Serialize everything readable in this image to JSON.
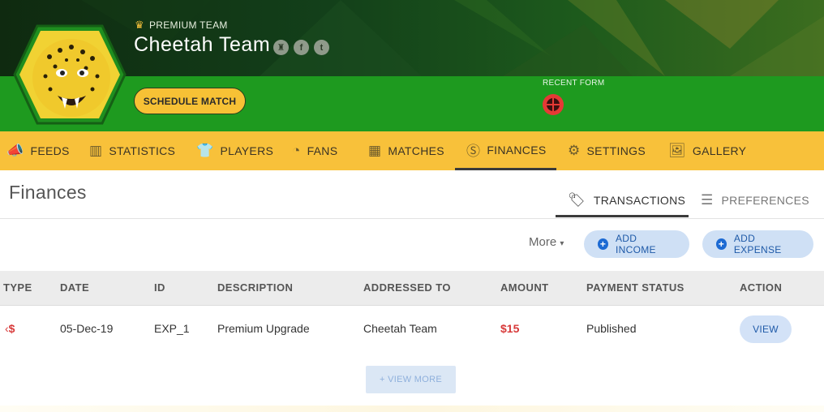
{
  "header": {
    "premium_label": "PREMIUM TEAM",
    "team_name": "Cheetah Team",
    "schedule_label": "SCHEDULE MATCH",
    "recent_form_label": "RECENT FORM",
    "social_icons": [
      "trophy-icon",
      "facebook-icon",
      "twitter-icon"
    ]
  },
  "nav": {
    "items": [
      {
        "label": "FEEDS",
        "icon": "megaphone-icon"
      },
      {
        "label": "STATISTICS",
        "icon": "bar-chart-icon"
      },
      {
        "label": "PLAYERS",
        "icon": "jersey-icon"
      },
      {
        "label": "FANS",
        "icon": "whistle-icon"
      },
      {
        "label": "MATCHES",
        "icon": "calendar-icon"
      },
      {
        "label": "FINANCES",
        "icon": "dollar-coin-icon"
      },
      {
        "label": "SETTINGS",
        "icon": "gear-icon"
      },
      {
        "label": "GALLERY",
        "icon": "image-icon"
      }
    ],
    "active": "FINANCES"
  },
  "page": {
    "title": "Finances",
    "tabs": [
      {
        "label": "TRANSACTIONS",
        "icon": "price-tag-icon"
      },
      {
        "label": "PREFERENCES",
        "icon": "sliders-icon"
      }
    ],
    "active_tab": "TRANSACTIONS"
  },
  "actions": {
    "more_label": "More",
    "add_income_label": "ADD INCOME",
    "add_expense_label": "ADD EXPENSE"
  },
  "table": {
    "columns": [
      "TYPE",
      "DATE",
      "ID",
      "DESCRIPTION",
      "ADDRESSED TO",
      "AMOUNT",
      "PAYMENT STATUS",
      "ACTION"
    ],
    "rows": [
      {
        "type": "$",
        "date": "05-Dec-19",
        "id": "EXP_1",
        "description": "Premium Upgrade",
        "addressed_to": "Cheetah Team",
        "amount": "$15",
        "status": "Published",
        "action": "VIEW"
      }
    ],
    "view_more_label": "+ VIEW MORE"
  },
  "colors": {
    "header_green": "#1e9a1f",
    "nav_yellow": "#f8c13a",
    "expense_red": "#d83a3a",
    "button_blue": "#1c6ad3"
  }
}
